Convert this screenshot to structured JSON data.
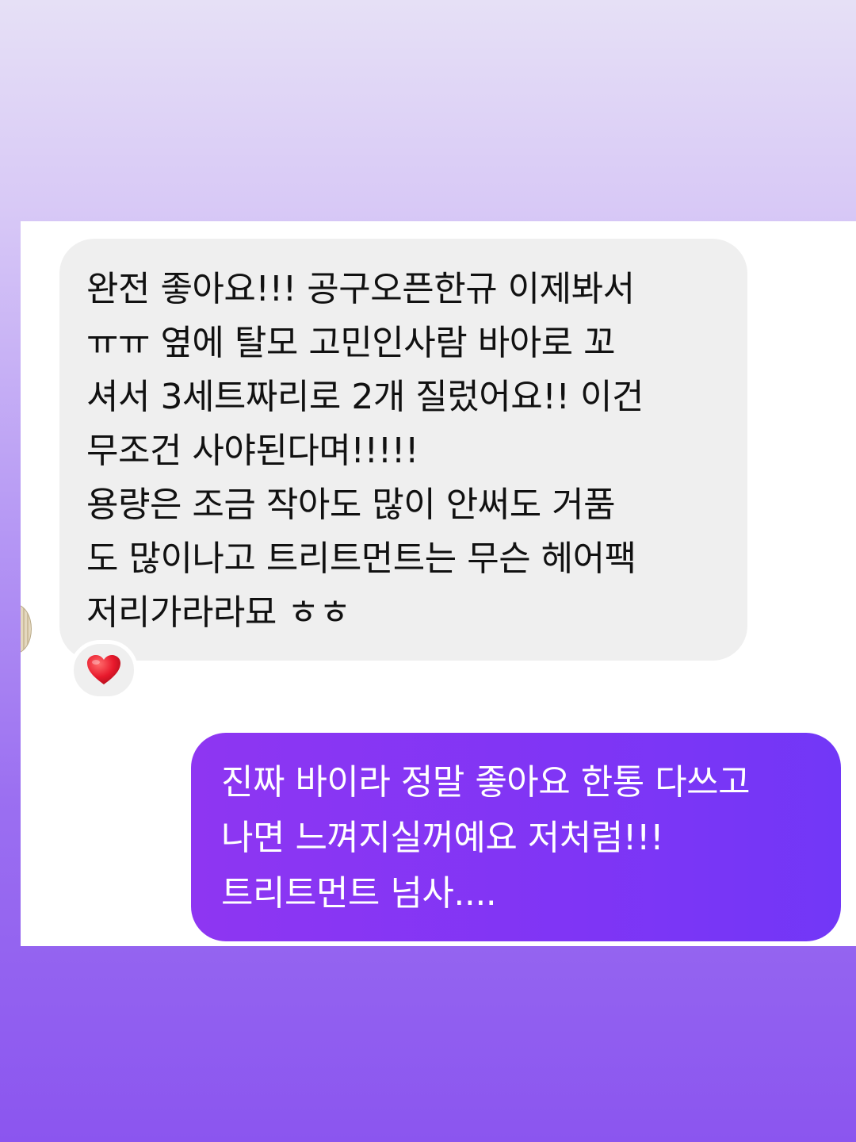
{
  "received_message": {
    "lines": [
      "완전 좋아요!!! 공구오픈한규 이제봐서",
      "ㅠㅠ 옆에 탈모 고민인사람 바아로 꼬",
      "셔서 3세트짜리로 2개 질렀어요!! 이건",
      "무조건 사야된다며!!!!!",
      "용량은 조금 작아도 많이 안써도 거품",
      "도 많이나고 트리트먼트는 무슨 헤어팩",
      "저리가라라묘 ㅎㅎ"
    ],
    "reaction": "heart-emoji"
  },
  "sent_message": {
    "lines": [
      "진짜 바이라 정말 좋아요 한통 다쓰고",
      "나면 느껴지실꺼예요 저처럼!!!",
      "트리트먼트 넘사...."
    ]
  },
  "colors": {
    "received_bubble": "#efefef",
    "sent_bubble": "#7f35f5",
    "background_top": "#e6e0f6",
    "background_bottom": "#8b55ef"
  }
}
